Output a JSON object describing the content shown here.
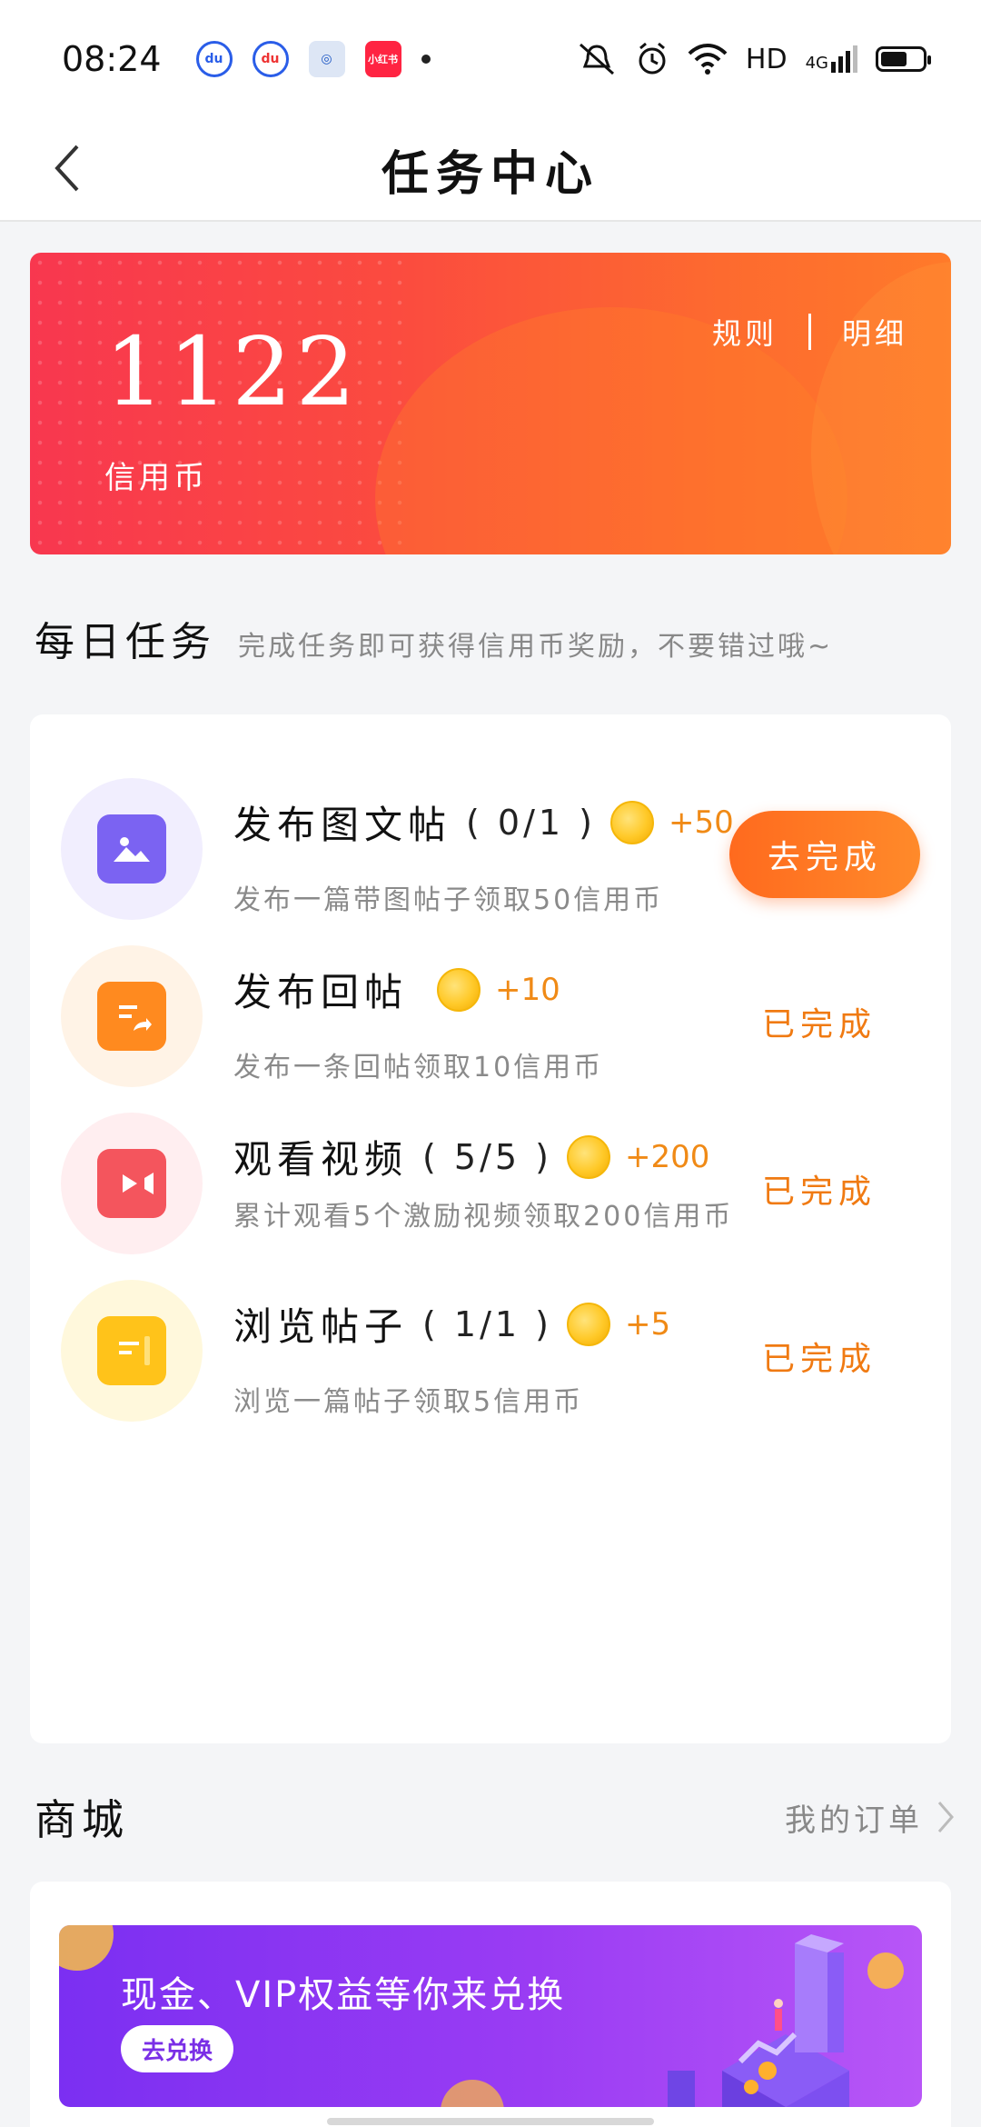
{
  "status_bar": {
    "time": "08:24",
    "network_label": "HD",
    "signal_label": "4G"
  },
  "header": {
    "title": "任务中心",
    "back_icon": "chevron-left-icon"
  },
  "coin_banner": {
    "amount": "1122",
    "unit": "信用币",
    "rules_label": "规则",
    "details_label": "明细"
  },
  "daily": {
    "title": "每日任务",
    "subtitle": "完成任务即可获得信用币奖励，不要错过哦~",
    "tasks": [
      {
        "title": "发布图文帖",
        "progress": "( 0/1 )",
        "reward": "+50",
        "desc": "发布一篇带图帖子领取50信用币",
        "action": "去完成",
        "icon": "image-icon",
        "accent": "#7b63f2"
      },
      {
        "title": "发布回帖",
        "progress": "",
        "reward": "+10",
        "desc": "发布一条回帖领取10信用币",
        "action": "已完成",
        "icon": "reply-document-icon",
        "accent": "#ff8a1f"
      },
      {
        "title": "观看视频",
        "progress": "( 5/5 )",
        "reward": "+200",
        "desc": "累计观看5个激励视频领取200信用币",
        "action": "已完成",
        "icon": "video-camera-icon",
        "accent": "#f4555d"
      },
      {
        "title": "浏览帖子",
        "progress": "( 1/1 )",
        "reward": "+5",
        "desc": "浏览一篇帖子领取5信用币",
        "action": "已完成",
        "icon": "document-icon",
        "accent": "#ffc31a"
      }
    ]
  },
  "shop": {
    "title": "商城",
    "orders_label": "我的订单",
    "promo_text": "现金、VIP权益等你来兑换",
    "redeem_label": "去兑换"
  }
}
